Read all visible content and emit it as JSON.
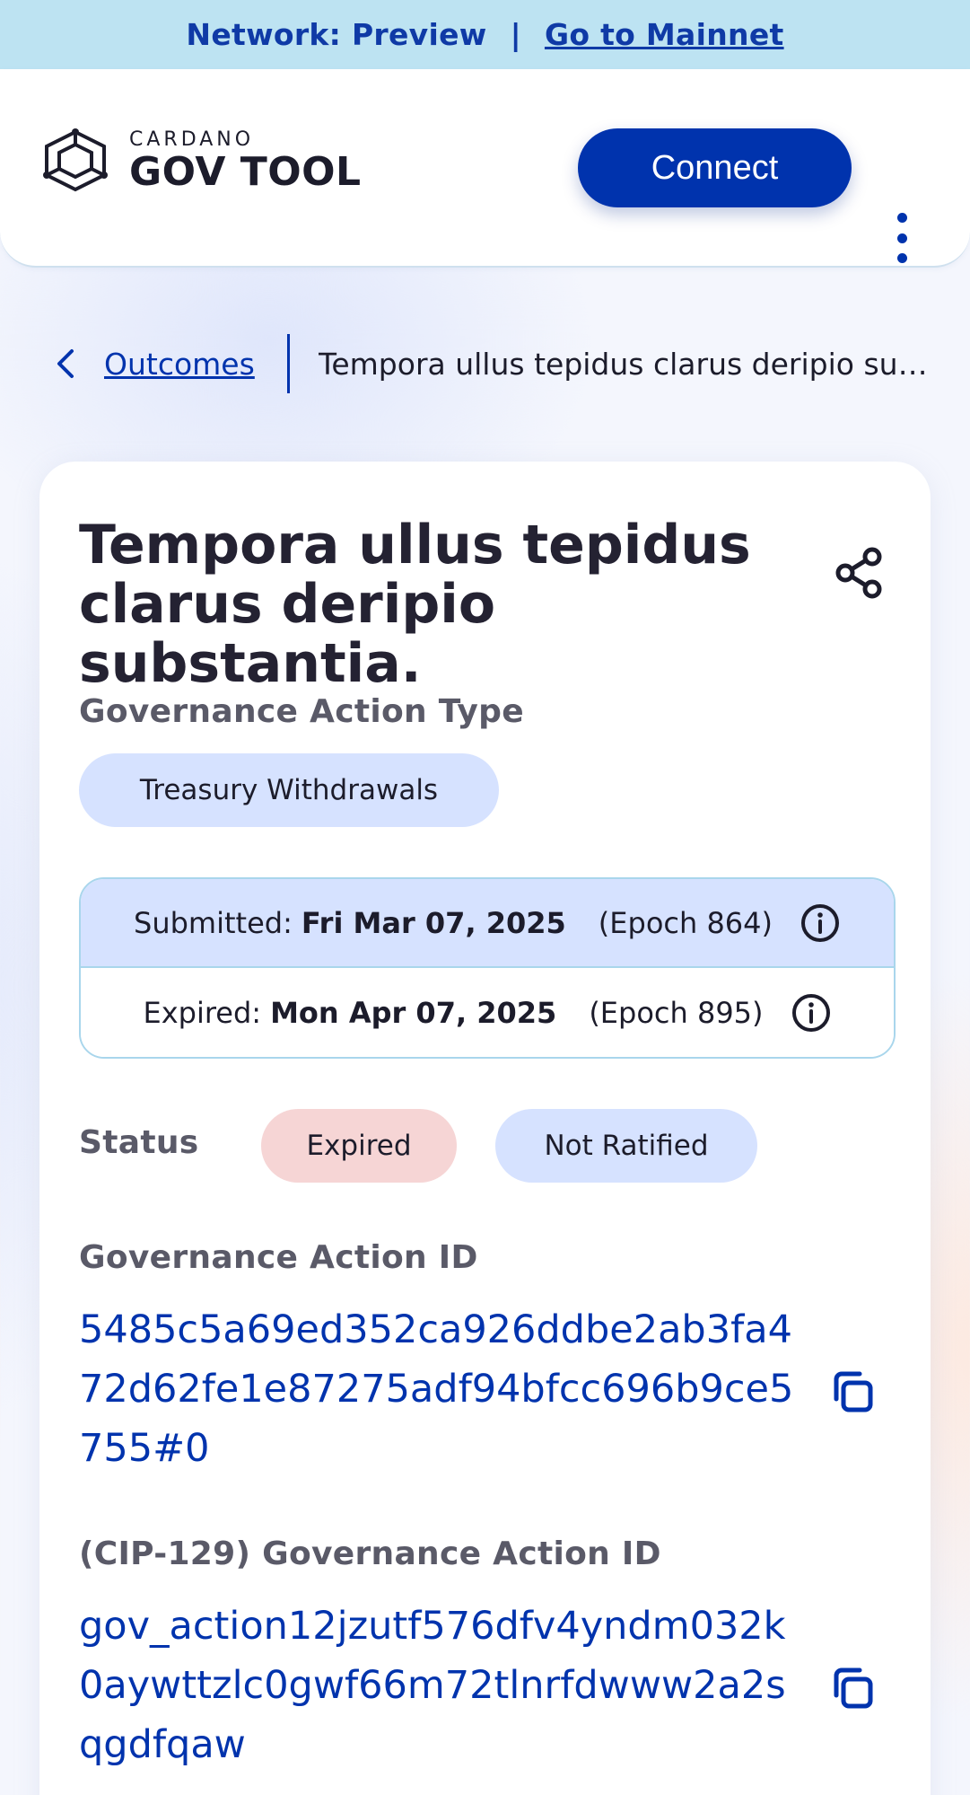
{
  "banner": {
    "network_text": "Network: Preview",
    "separator": "|",
    "mainnet_link": "Go to Mainnet"
  },
  "header": {
    "logo_small": "CARDANO",
    "logo_big": "GOV TOOL",
    "connect_label": "Connect"
  },
  "breadcrumb": {
    "parent": "Outcomes",
    "current": "Tempora ullus tepidus clarus deripio substantia."
  },
  "card": {
    "title": "Tempora ullus tepidus clarus deripio substantia.",
    "action_type_label": "Governance Action Type",
    "action_type_value": "Treasury Withdrawals",
    "submitted": {
      "label": "Submitted:",
      "date": "Fri Mar 07, 2025",
      "epoch": "(Epoch 864)"
    },
    "expired": {
      "label": "Expired:",
      "date": "Mon Apr 07, 2025",
      "epoch": "(Epoch 895)"
    },
    "status_label": "Status",
    "status_badges": [
      "Expired",
      "Not Ratified"
    ],
    "action_id_label": "Governance Action ID",
    "action_id_value": "5485c5a69ed352ca926ddbe2ab3fa472d62fe1e87275adf94bfcc696b9ce5755#0",
    "cip129_label": "(CIP-129) Governance Action ID",
    "cip129_value": "gov_action12jzutf576dfv4yndm032k0aywttzlc0gwf66m72tlnrfdwww2a2sqgdfqaw"
  },
  "colors": {
    "primary": "#0033ad",
    "banner_bg": "#bde3f2",
    "pill_blue": "#d6e2ff",
    "pill_red": "#f6d5d5"
  },
  "icons": [
    "cardano-logo-icon",
    "chevron-left-icon",
    "share-icon",
    "info-icon",
    "copy-icon",
    "kebab-menu-icon"
  ]
}
